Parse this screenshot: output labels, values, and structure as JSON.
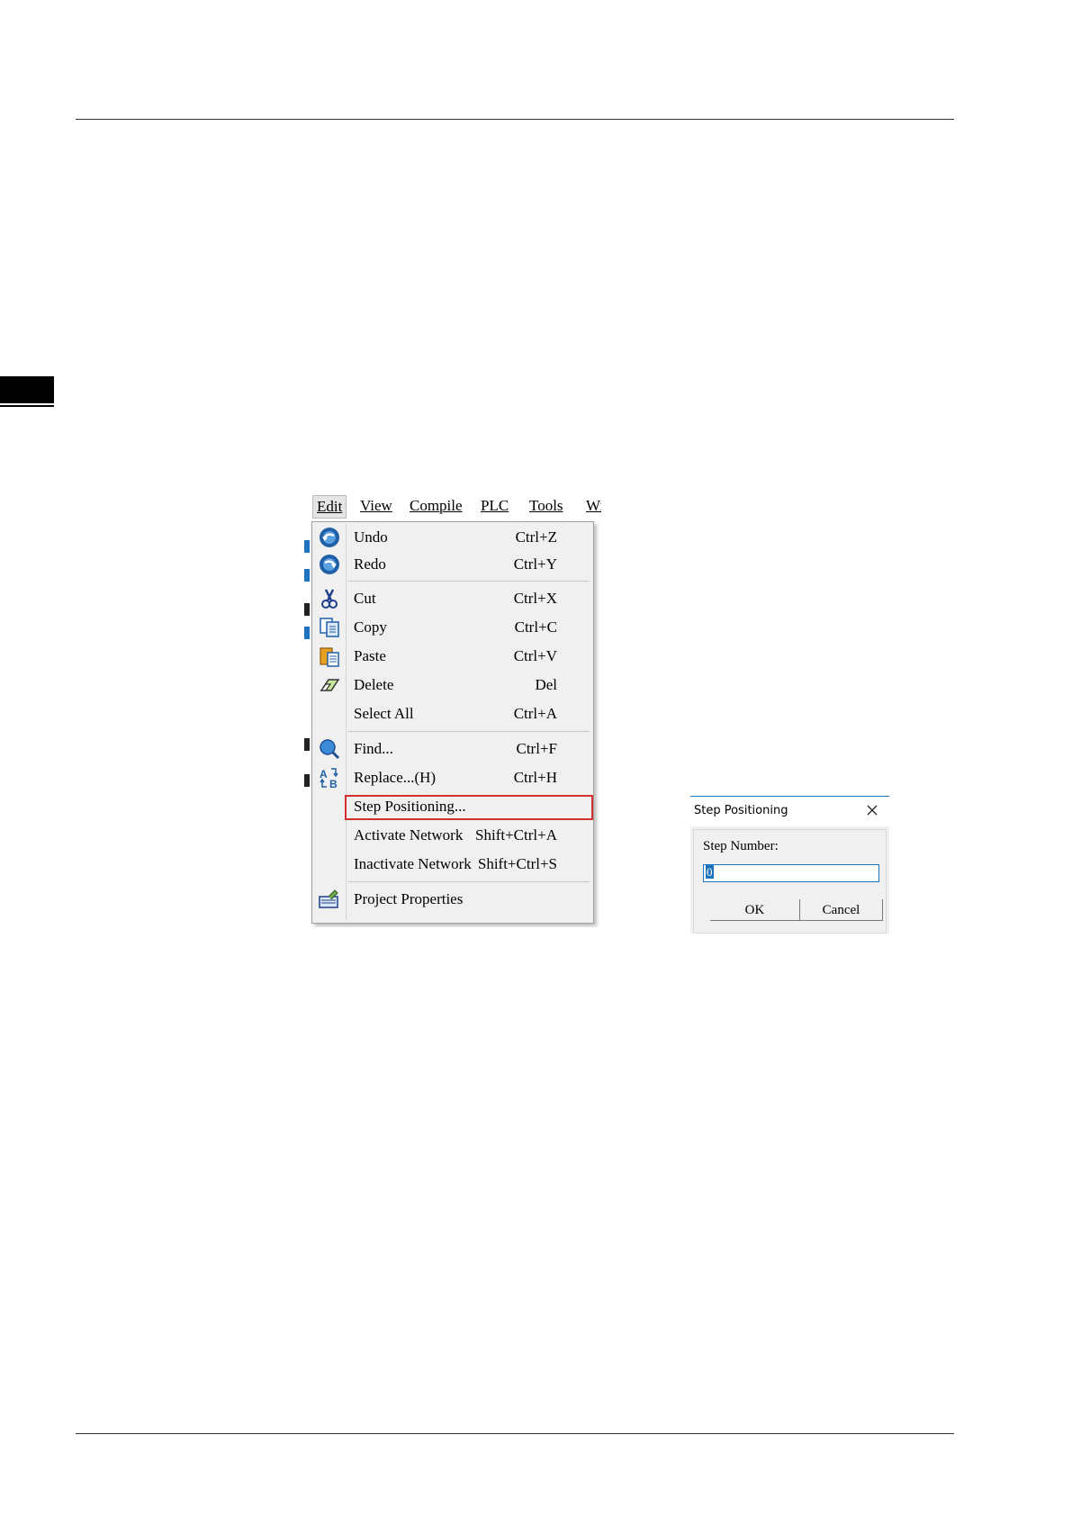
{
  "menubar": {
    "items": [
      {
        "label": "Edit"
      },
      {
        "label": "View"
      },
      {
        "label": "Compile"
      },
      {
        "label": "PLC"
      },
      {
        "label": "Tools"
      },
      {
        "label": "Wi"
      }
    ]
  },
  "edit_menu": {
    "items": [
      {
        "label": "Undo",
        "shortcut": "Ctrl+Z",
        "icon": "undo-icon"
      },
      {
        "label": "Redo",
        "shortcut": "Ctrl+Y",
        "icon": "redo-icon"
      },
      {
        "label": "Cut",
        "shortcut": "Ctrl+X",
        "icon": "scissors-icon"
      },
      {
        "label": "Copy",
        "shortcut": "Ctrl+C",
        "icon": "copy-icon"
      },
      {
        "label": "Paste",
        "shortcut": "Ctrl+V",
        "icon": "paste-icon"
      },
      {
        "label": "Delete",
        "shortcut": "Del",
        "icon": "eraser-icon"
      },
      {
        "label": "Select All",
        "shortcut": "Ctrl+A"
      },
      {
        "label": "Find...",
        "shortcut": "Ctrl+F",
        "icon": "magnifier-icon"
      },
      {
        "label": "Replace...(H)",
        "shortcut": "Ctrl+H",
        "icon": "replace-icon"
      },
      {
        "label": "Step Positioning...",
        "shortcut": "",
        "highlighted": true
      },
      {
        "label": "Activate Network",
        "shortcut": "Shift+Ctrl+A"
      },
      {
        "label": "Inactivate Network",
        "shortcut": "Shift+Ctrl+S"
      },
      {
        "label": "Project Properties",
        "shortcut": "",
        "icon": "properties-icon"
      }
    ]
  },
  "dialog": {
    "title": "Step Positioning",
    "field_label": "Step Number:",
    "field_value": "0",
    "ok_label": "OK",
    "cancel_label": "Cancel"
  },
  "colors": {
    "highlight_border": "#d32f2f",
    "accent_blue": "#1e73be",
    "menu_bg": "#f0f0f0"
  }
}
